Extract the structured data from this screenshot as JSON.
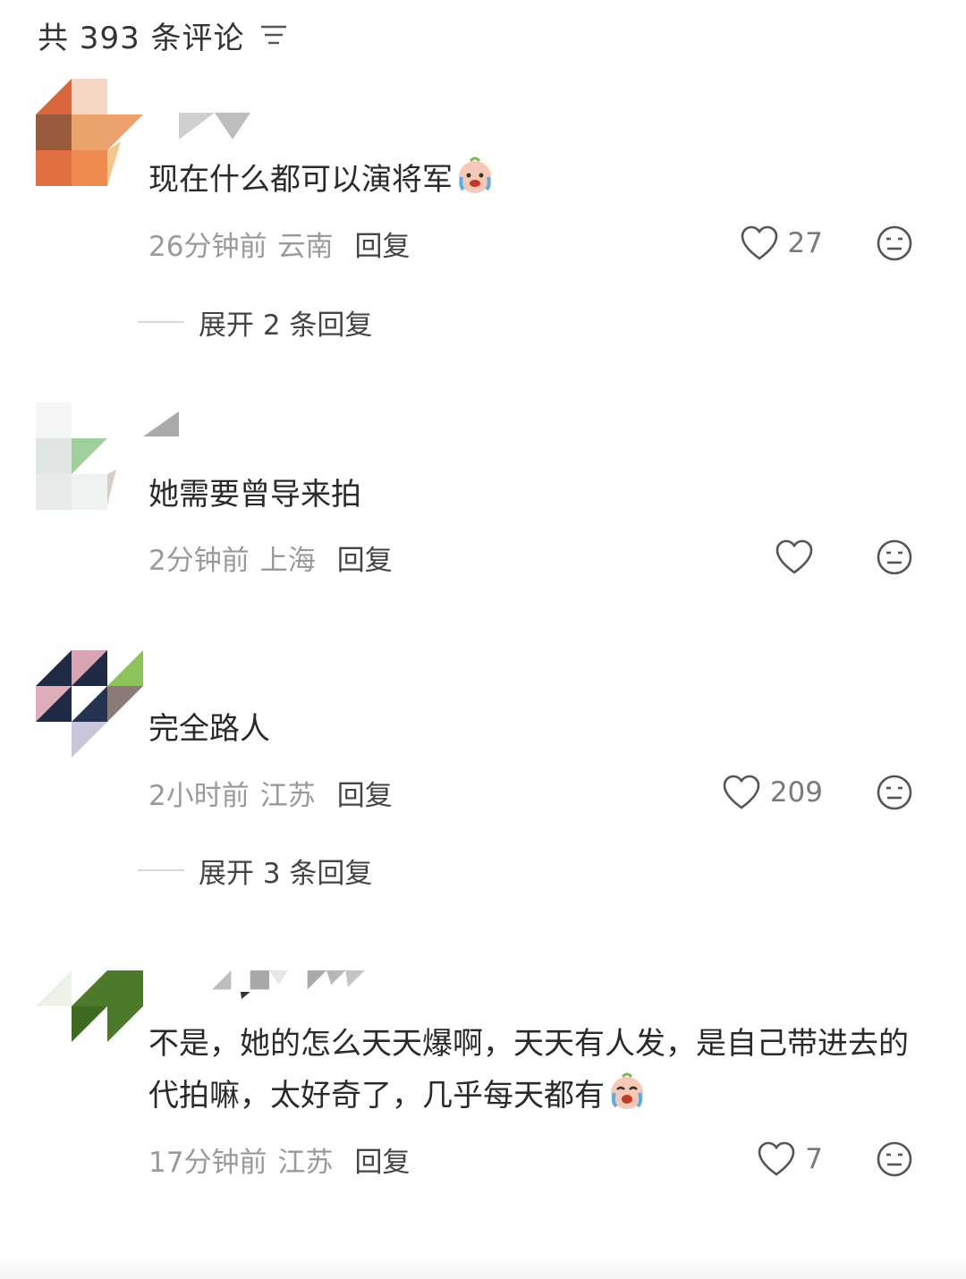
{
  "header": {
    "title": "共 393 条评论"
  },
  "comments": [
    {
      "text": "现在什么都可以演将军",
      "time": "26分钟前",
      "location": "云南",
      "reply_label": "回复",
      "likes": "27",
      "expand_label": "展开 2 条回复",
      "avatar_colors": [
        "#d9653d",
        "#e8a26a",
        "#f2c09a",
        "#c9532f"
      ]
    },
    {
      "text": "她需要曾导来拍",
      "time": "2分钟前",
      "location": "上海",
      "reply_label": "回复",
      "likes": "",
      "avatar_colors": [
        "#e6ebe8",
        "#9fd09b",
        "#cfd8d4",
        "#f0f3f1"
      ]
    },
    {
      "text": "完全路人",
      "time": "2小时前",
      "location": "江苏",
      "reply_label": "回复",
      "likes": "209",
      "expand_label": "展开 3 条回复",
      "avatar_colors": [
        "#1f2a44",
        "#d9a3b1",
        "#c9c6dc",
        "#8cc35b"
      ]
    },
    {
      "text": "不是，她的怎么天天爆啊，天天有人发，是自己带进去的代拍嘛，太好奇了，几乎每天都有",
      "time": "17分钟前",
      "location": "江苏",
      "reply_label": "回复",
      "likes": "7",
      "avatar_colors": [
        "#4c7a2c",
        "#ffffff"
      ]
    }
  ],
  "icons": {
    "like": "heart-outline-icon",
    "dislike": "neutral-face-icon",
    "filter": "filter-lines-icon",
    "emoji": "crying-face-emoji"
  }
}
